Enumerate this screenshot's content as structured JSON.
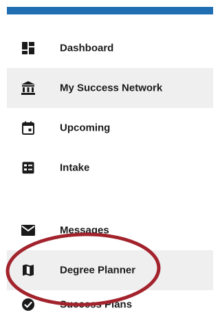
{
  "colors": {
    "top_bar": "#1f6fb2",
    "row_shade": "#efefef",
    "annotation_ellipse": "#a3232d",
    "text": "#1a1a1a"
  },
  "nav": {
    "items": [
      {
        "label": "Dashboard",
        "icon": "dashboard-icon",
        "shaded": false
      },
      {
        "label": "My Success Network",
        "icon": "bank-icon",
        "shaded": true
      },
      {
        "label": "Upcoming",
        "icon": "calendar-icon",
        "shaded": false
      },
      {
        "label": "Intake",
        "icon": "intake-form-icon",
        "shaded": false
      },
      {
        "label": "Messages",
        "icon": "envelope-icon",
        "shaded": false
      },
      {
        "label": "Degree Planner",
        "icon": "map-icon",
        "shaded": true
      },
      {
        "label": "Success Plans",
        "icon": "check-circle-icon",
        "shaded": false
      }
    ]
  },
  "annotation": {
    "shape": "ellipse",
    "target": "Degree Planner"
  }
}
